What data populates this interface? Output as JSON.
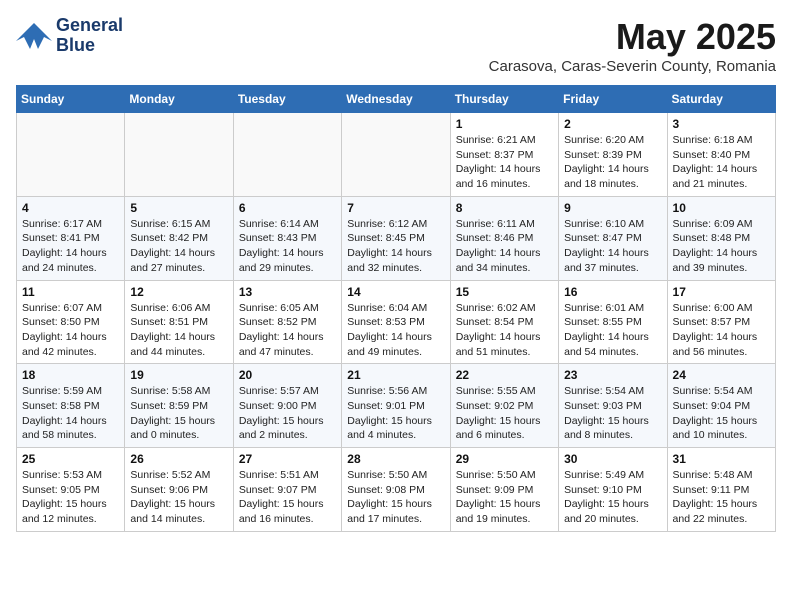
{
  "header": {
    "logo_line1": "General",
    "logo_line2": "Blue",
    "month_year": "May 2025",
    "subtitle": "Carasova, Caras-Severin County, Romania"
  },
  "days_of_week": [
    "Sunday",
    "Monday",
    "Tuesday",
    "Wednesday",
    "Thursday",
    "Friday",
    "Saturday"
  ],
  "weeks": [
    [
      {
        "day": "",
        "info": ""
      },
      {
        "day": "",
        "info": ""
      },
      {
        "day": "",
        "info": ""
      },
      {
        "day": "",
        "info": ""
      },
      {
        "day": "1",
        "info": "Sunrise: 6:21 AM\nSunset: 8:37 PM\nDaylight: 14 hours and 16 minutes."
      },
      {
        "day": "2",
        "info": "Sunrise: 6:20 AM\nSunset: 8:39 PM\nDaylight: 14 hours and 18 minutes."
      },
      {
        "day": "3",
        "info": "Sunrise: 6:18 AM\nSunset: 8:40 PM\nDaylight: 14 hours and 21 minutes."
      }
    ],
    [
      {
        "day": "4",
        "info": "Sunrise: 6:17 AM\nSunset: 8:41 PM\nDaylight: 14 hours and 24 minutes."
      },
      {
        "day": "5",
        "info": "Sunrise: 6:15 AM\nSunset: 8:42 PM\nDaylight: 14 hours and 27 minutes."
      },
      {
        "day": "6",
        "info": "Sunrise: 6:14 AM\nSunset: 8:43 PM\nDaylight: 14 hours and 29 minutes."
      },
      {
        "day": "7",
        "info": "Sunrise: 6:12 AM\nSunset: 8:45 PM\nDaylight: 14 hours and 32 minutes."
      },
      {
        "day": "8",
        "info": "Sunrise: 6:11 AM\nSunset: 8:46 PM\nDaylight: 14 hours and 34 minutes."
      },
      {
        "day": "9",
        "info": "Sunrise: 6:10 AM\nSunset: 8:47 PM\nDaylight: 14 hours and 37 minutes."
      },
      {
        "day": "10",
        "info": "Sunrise: 6:09 AM\nSunset: 8:48 PM\nDaylight: 14 hours and 39 minutes."
      }
    ],
    [
      {
        "day": "11",
        "info": "Sunrise: 6:07 AM\nSunset: 8:50 PM\nDaylight: 14 hours and 42 minutes."
      },
      {
        "day": "12",
        "info": "Sunrise: 6:06 AM\nSunset: 8:51 PM\nDaylight: 14 hours and 44 minutes."
      },
      {
        "day": "13",
        "info": "Sunrise: 6:05 AM\nSunset: 8:52 PM\nDaylight: 14 hours and 47 minutes."
      },
      {
        "day": "14",
        "info": "Sunrise: 6:04 AM\nSunset: 8:53 PM\nDaylight: 14 hours and 49 minutes."
      },
      {
        "day": "15",
        "info": "Sunrise: 6:02 AM\nSunset: 8:54 PM\nDaylight: 14 hours and 51 minutes."
      },
      {
        "day": "16",
        "info": "Sunrise: 6:01 AM\nSunset: 8:55 PM\nDaylight: 14 hours and 54 minutes."
      },
      {
        "day": "17",
        "info": "Sunrise: 6:00 AM\nSunset: 8:57 PM\nDaylight: 14 hours and 56 minutes."
      }
    ],
    [
      {
        "day": "18",
        "info": "Sunrise: 5:59 AM\nSunset: 8:58 PM\nDaylight: 14 hours and 58 minutes."
      },
      {
        "day": "19",
        "info": "Sunrise: 5:58 AM\nSunset: 8:59 PM\nDaylight: 15 hours and 0 minutes."
      },
      {
        "day": "20",
        "info": "Sunrise: 5:57 AM\nSunset: 9:00 PM\nDaylight: 15 hours and 2 minutes."
      },
      {
        "day": "21",
        "info": "Sunrise: 5:56 AM\nSunset: 9:01 PM\nDaylight: 15 hours and 4 minutes."
      },
      {
        "day": "22",
        "info": "Sunrise: 5:55 AM\nSunset: 9:02 PM\nDaylight: 15 hours and 6 minutes."
      },
      {
        "day": "23",
        "info": "Sunrise: 5:54 AM\nSunset: 9:03 PM\nDaylight: 15 hours and 8 minutes."
      },
      {
        "day": "24",
        "info": "Sunrise: 5:54 AM\nSunset: 9:04 PM\nDaylight: 15 hours and 10 minutes."
      }
    ],
    [
      {
        "day": "25",
        "info": "Sunrise: 5:53 AM\nSunset: 9:05 PM\nDaylight: 15 hours and 12 minutes."
      },
      {
        "day": "26",
        "info": "Sunrise: 5:52 AM\nSunset: 9:06 PM\nDaylight: 15 hours and 14 minutes."
      },
      {
        "day": "27",
        "info": "Sunrise: 5:51 AM\nSunset: 9:07 PM\nDaylight: 15 hours and 16 minutes."
      },
      {
        "day": "28",
        "info": "Sunrise: 5:50 AM\nSunset: 9:08 PM\nDaylight: 15 hours and 17 minutes."
      },
      {
        "day": "29",
        "info": "Sunrise: 5:50 AM\nSunset: 9:09 PM\nDaylight: 15 hours and 19 minutes."
      },
      {
        "day": "30",
        "info": "Sunrise: 5:49 AM\nSunset: 9:10 PM\nDaylight: 15 hours and 20 minutes."
      },
      {
        "day": "31",
        "info": "Sunrise: 5:48 AM\nSunset: 9:11 PM\nDaylight: 15 hours and 22 minutes."
      }
    ]
  ]
}
